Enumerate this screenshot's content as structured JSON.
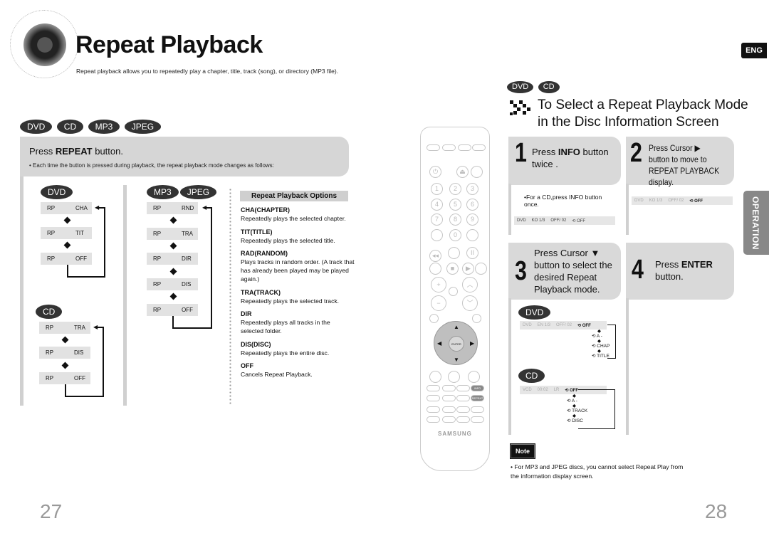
{
  "page_left": {
    "title": "Repeat Playback",
    "subtitle": "Repeat playback allows you to repeatedly play a chapter, title, track (song), or directory (MP3 file).",
    "disc_badges": [
      "DVD",
      "CD",
      "MP3",
      "JPEG"
    ],
    "press_heading_prefix": "Press ",
    "press_heading_bold": "REPEAT",
    "press_heading_suffix": " button.",
    "press_note": "• Each time the button is pressed during playback, the repeat playback mode changes as follows:",
    "dvd_cycle": {
      "badge": "DVD",
      "items": [
        [
          "RP",
          "CHA"
        ],
        [
          "RP",
          "TIT"
        ],
        [
          "RP",
          "OFF"
        ]
      ]
    },
    "cd_cycle": {
      "badge": "CD",
      "items": [
        [
          "RP",
          "TRA"
        ],
        [
          "RP",
          "DIS"
        ],
        [
          "RP",
          "OFF"
        ]
      ]
    },
    "mp3_cycle": {
      "badges": [
        "MP3",
        "JPEG"
      ],
      "items": [
        [
          "RP",
          "RND"
        ],
        [
          "RP",
          "TRA"
        ],
        [
          "RP",
          "DIR"
        ],
        [
          "RP",
          "DIS"
        ],
        [
          "RP",
          "OFF"
        ]
      ]
    },
    "options_heading": "Repeat Playback Options",
    "options": [
      {
        "name": "CHA(CHAPTER)",
        "desc": "Repeatedly plays the selected chapter."
      },
      {
        "name": "TIT(TITLE)",
        "desc": "Repeatedly plays the selected title."
      },
      {
        "name": "RAD(RANDOM)",
        "desc": "Plays tracks in random order. (A track that has already been played may be played again.)"
      },
      {
        "name": "TRA(TRACK)",
        "desc": "Repeatedly plays the selected track."
      },
      {
        "name": "DIR",
        "desc": "Repeatedly plays all tracks in the selected folder."
      },
      {
        "name": "DIS(DISC)",
        "desc": "Repeatedly plays the entire disc."
      },
      {
        "name": "OFF",
        "desc": "Cancels Repeat Playback."
      }
    ],
    "page_number": "27"
  },
  "remote": {
    "brand": "SAMSUNG",
    "numbers": [
      "1",
      "2",
      "3",
      "4",
      "5",
      "6",
      "7",
      "8",
      "9",
      "0"
    ],
    "enter_label": "ENTER",
    "highlight_buttons": [
      "INFO",
      "REPEAT"
    ]
  },
  "page_right": {
    "lang_tab": "ENG",
    "disc_badges": [
      "DVD",
      "CD"
    ],
    "section_title_line1": "To Select a Repeat Playback Mode",
    "section_title_line2": "in the Disc Information Screen",
    "steps": [
      {
        "num": "1",
        "prefix": "Press ",
        "bold": "INFO",
        "suffix": " button twice .",
        "sub": "•For a CD,press INFO button once."
      },
      {
        "num": "2",
        "text": "Press Cursor ▶ button to move to REPEAT PLAYBACK display."
      },
      {
        "num": "3",
        "text": "Press Cursor ▼ button to select the desired Repeat Playback mode."
      },
      {
        "num": "4",
        "prefix": "Press ",
        "bold": "ENTER",
        "suffix": " button."
      }
    ],
    "osd_step1": [
      "DVD",
      "KO 1/3",
      "OFF/ 02",
      "OFF"
    ],
    "osd_step2": [
      "DVD",
      "KO 1/3",
      "OFF/ 02",
      "OFF"
    ],
    "dvd_modes": {
      "badge": "DVD",
      "osd": [
        "DVD",
        "EN 1/3",
        "OFF/ 02",
        "OFF"
      ],
      "modes": [
        "OFF",
        "A -",
        "CHAP",
        "TITLE"
      ]
    },
    "cd_modes": {
      "badge": "CD",
      "osd": [
        "VCD",
        "00:02",
        "LR",
        "OFF"
      ],
      "modes": [
        "OFF",
        "A -",
        "TRACK",
        "DISC"
      ]
    },
    "side_tab": "OPERATION",
    "note_badge": "Note",
    "note_text": "• For MP3 and JPEG discs, you cannot select Repeat Play from the information display screen.",
    "page_number": "28"
  }
}
